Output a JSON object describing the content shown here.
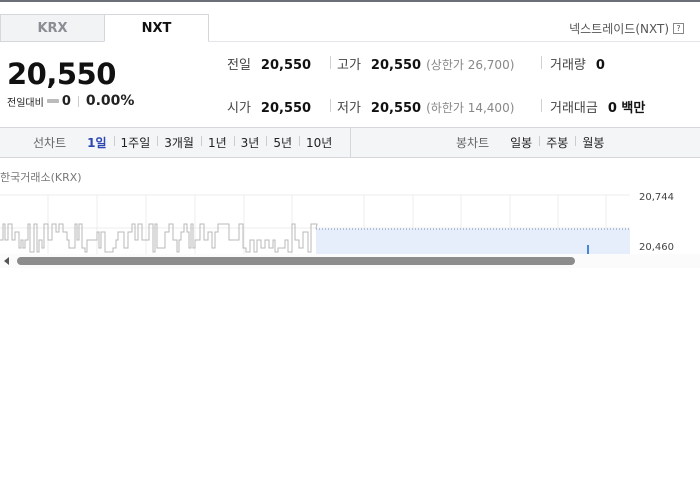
{
  "tabs": [
    {
      "label": "KRX"
    },
    {
      "label": "NXT"
    }
  ],
  "market_label": "넥스트레이드(NXT)",
  "help_icon": "?",
  "quote": {
    "price": "20,550",
    "change_label": "전일대비",
    "change_value": "0",
    "change_percent": "0.00%"
  },
  "stats": {
    "prev_close": {
      "label": "전일",
      "value": "20,550"
    },
    "open": {
      "label": "시가",
      "value": "20,550"
    },
    "high": {
      "label": "고가",
      "value": "20,550",
      "limit_label": "(상한가 26,700)"
    },
    "low": {
      "label": "저가",
      "value": "20,550",
      "limit_label": "(하한가 14,400)"
    },
    "volume": {
      "label": "거래량",
      "value": "0"
    },
    "amount": {
      "label": "거래대금",
      "value": "0 백만"
    }
  },
  "toolbar": {
    "line_label": "선차트",
    "line_items": [
      "1일",
      "1주일",
      "3개월",
      "1년",
      "3년",
      "5년",
      "10년"
    ],
    "active_index": 0,
    "candle_label": "봉차트",
    "candle_items": [
      "일봉",
      "주봉",
      "월봉"
    ]
  },
  "chart_caption": "한국거래소(KRX)",
  "chart_data": {
    "type": "line",
    "y_tick_labels": [
      "20,744",
      "20,460"
    ]
  },
  "colors": {
    "active_tab_text": "#2a46b0",
    "line": "#b8b8b8",
    "area_fill": "#e6eefb",
    "dotted_line": "#6f8fbf"
  }
}
